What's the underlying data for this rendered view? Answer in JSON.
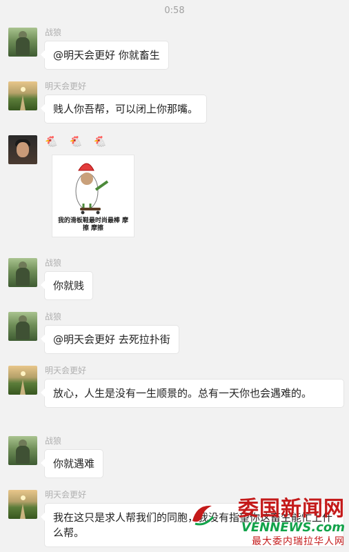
{
  "time": "0:58",
  "users": {
    "zhanlang": "战狼",
    "mingtian": "明天会更好"
  },
  "messages": [
    {
      "sender": "战狼",
      "text": "@明天会更好 你就畜生"
    },
    {
      "sender": "明天会更好",
      "text": "贱人你吾帮，可以闭上你那嘴。"
    },
    {
      "sender": "",
      "emoji": "🐔 🐔 🐔",
      "sticker_caption": "我的滑板鞋最时尚最棒 摩擦 摩擦"
    },
    {
      "sender": "战狼",
      "text": "你就贱"
    },
    {
      "sender": "战狼",
      "text": "@明天会更好 去死拉扑街"
    },
    {
      "sender": "明天会更好",
      "text": "放心，人生是没有一生顺景的。总有一天你也会遇难的。"
    },
    {
      "sender": "战狼",
      "text": "你就遇难"
    },
    {
      "sender": "明天会更好",
      "text": "我在这只是求人帮我们的同胞，我没有指望你这畜生能忙上什么帮。"
    }
  ],
  "watermark": {
    "title": "委国新闻网",
    "english": "VENNEWS.com",
    "subtitle": "最大委内瑞拉华人网"
  }
}
